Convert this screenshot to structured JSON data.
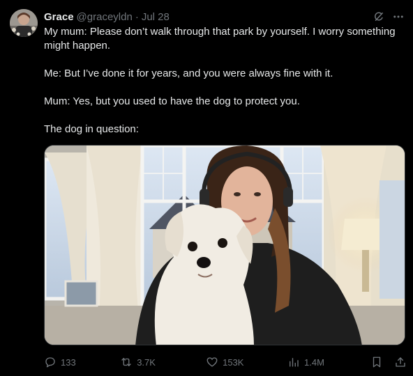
{
  "tweet": {
    "display_name": "Grace",
    "handle": "@graceyldn",
    "separator": "·",
    "date": "Jul 28",
    "paragraphs": [
      "My mum: Please don’t walk through that park by yourself. I worry something might happen.",
      "Me: But I’ve done it for years, and you were always fine with it.",
      "Mum: Yes, but you used to have the dog to protect you.",
      "The dog in question:"
    ]
  },
  "actions": {
    "replies": "133",
    "reposts": "3.7K",
    "likes": "153K",
    "views": "1.4M"
  },
  "icons": {
    "header": [
      "grok-icon",
      "more-options-icon"
    ],
    "actions": [
      "reply-icon",
      "repost-icon",
      "like-icon",
      "views-icon",
      "bookmark-icon",
      "share-icon"
    ]
  },
  "colors": {
    "background": "#000000",
    "text_primary": "#e7e9ea",
    "text_secondary": "#71767b",
    "border": "#2f3336"
  }
}
